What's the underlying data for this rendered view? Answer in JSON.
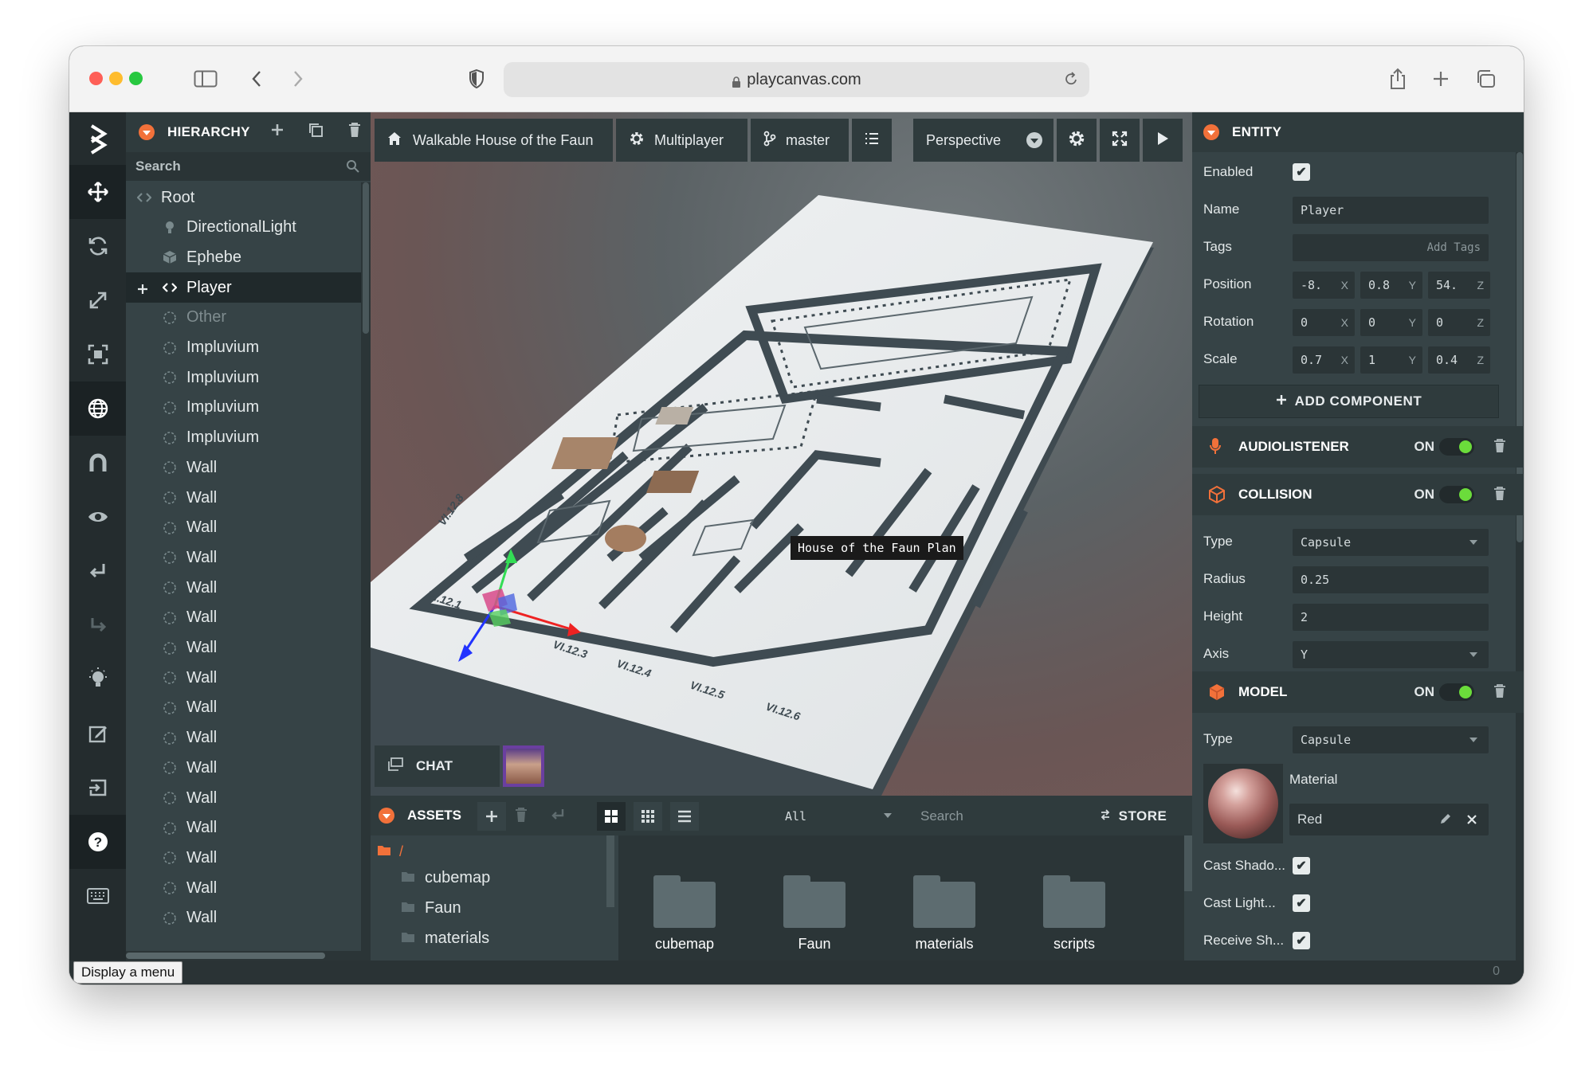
{
  "browser": {
    "url": "playcanvas.com",
    "traffic_lights": [
      "#fe5f57",
      "#febc2e",
      "#28c840"
    ]
  },
  "hierarchy": {
    "title": "HIERARCHY",
    "search_placeholder": "Search",
    "items": [
      {
        "label": "Root",
        "icon": "code-icon",
        "state": "normal"
      },
      {
        "label": "DirectionalLight",
        "icon": "light-icon",
        "state": "normal"
      },
      {
        "label": "Ephebe",
        "icon": "cube-icon",
        "state": "normal"
      },
      {
        "label": "Player",
        "icon": "code-icon",
        "state": "selected"
      },
      {
        "label": "Other",
        "icon": "entity-icon",
        "state": "dim"
      },
      {
        "label": "Impluvium",
        "icon": "entity-icon",
        "state": "normal"
      },
      {
        "label": "Impluvium",
        "icon": "entity-icon",
        "state": "normal"
      },
      {
        "label": "Impluvium",
        "icon": "entity-icon",
        "state": "normal"
      },
      {
        "label": "Impluvium",
        "icon": "entity-icon",
        "state": "normal"
      },
      {
        "label": "Wall",
        "icon": "entity-icon",
        "state": "normal"
      },
      {
        "label": "Wall",
        "icon": "entity-icon",
        "state": "normal"
      },
      {
        "label": "Wall",
        "icon": "entity-icon",
        "state": "normal"
      },
      {
        "label": "Wall",
        "icon": "entity-icon",
        "state": "normal"
      },
      {
        "label": "Wall",
        "icon": "entity-icon",
        "state": "normal"
      },
      {
        "label": "Wall",
        "icon": "entity-icon",
        "state": "normal"
      },
      {
        "label": "Wall",
        "icon": "entity-icon",
        "state": "normal"
      },
      {
        "label": "Wall",
        "icon": "entity-icon",
        "state": "normal"
      },
      {
        "label": "Wall",
        "icon": "entity-icon",
        "state": "normal"
      },
      {
        "label": "Wall",
        "icon": "entity-icon",
        "state": "normal"
      },
      {
        "label": "Wall",
        "icon": "entity-icon",
        "state": "normal"
      },
      {
        "label": "Wall",
        "icon": "entity-icon",
        "state": "normal"
      },
      {
        "label": "Wall",
        "icon": "entity-icon",
        "state": "normal"
      },
      {
        "label": "Wall",
        "icon": "entity-icon",
        "state": "normal"
      },
      {
        "label": "Wall",
        "icon": "entity-icon",
        "state": "normal"
      },
      {
        "label": "Wall",
        "icon": "entity-icon",
        "state": "normal"
      }
    ]
  },
  "viewport": {
    "project_name": "Walkable House of the Faun",
    "multiplayer_label": "Multiplayer",
    "branch": "master",
    "camera": "Perspective",
    "tooltip": "House of the Faun Plan",
    "chat_label": "CHAT",
    "plan_labels": [
      "VI.12.1",
      "VI.12.3",
      "VI.12.4",
      "VI.12.5",
      "VI.12.6",
      "VI.12.8"
    ]
  },
  "assets": {
    "title": "ASSETS",
    "filter": "All",
    "search_placeholder": "Search",
    "store_label": "STORE",
    "root_path": "/",
    "tree": [
      "cubemap",
      "Faun",
      "materials"
    ],
    "folders": [
      "cubemap",
      "Faun",
      "materials",
      "scripts"
    ]
  },
  "inspector": {
    "title": "ENTITY",
    "enabled_label": "Enabled",
    "name_label": "Name",
    "name_value": "Player",
    "tags_label": "Tags",
    "tags_placeholder": "Add Tags",
    "position_label": "Position",
    "position": [
      "-8.",
      "0.8",
      "54."
    ],
    "rotation_label": "Rotation",
    "rotation": [
      "0",
      "0",
      "0"
    ],
    "scale_label": "Scale",
    "scale": [
      "0.7",
      "1",
      "0.4"
    ],
    "axis_x": "X",
    "axis_y": "Y",
    "axis_z": "Z",
    "add_component": "ADD COMPONENT",
    "on_label": "ON",
    "audiolistener": {
      "title": "AUDIOLISTENER"
    },
    "collision": {
      "title": "COLLISION",
      "type_label": "Type",
      "type_value": "Capsule",
      "radius_label": "Radius",
      "radius_value": "0.25",
      "height_label": "Height",
      "height_value": "2",
      "axis_label": "Axis",
      "axis_value": "Y"
    },
    "model": {
      "title": "MODEL",
      "type_label": "Type",
      "type_value": "Capsule",
      "material_label": "Material",
      "material_value": "Red",
      "cast_shadows": "Cast Shado...",
      "cast_lightmap": "Cast Light...",
      "receive_shadows": "Receive Sh..."
    }
  },
  "status": {
    "tooltip": "Display a menu",
    "count": "0"
  },
  "colors": {
    "accent": "#f2713a",
    "toggle_on": "#6bdc3b"
  }
}
